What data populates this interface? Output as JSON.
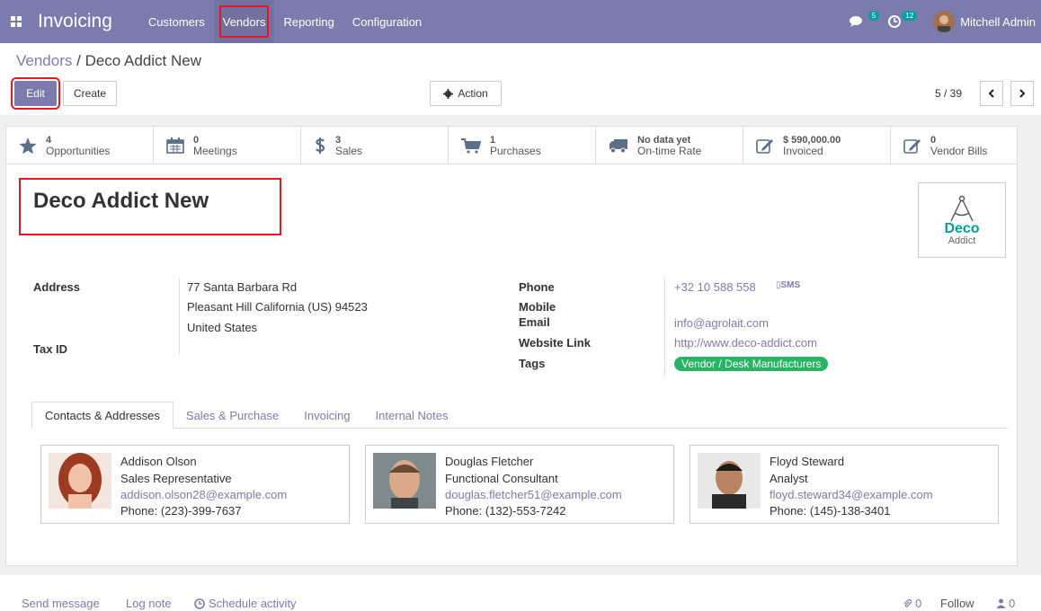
{
  "navbar": {
    "brand": "Invoicing",
    "menu": [
      "Customers",
      "Vendors",
      "Reporting",
      "Configuration"
    ],
    "messages_count": "5",
    "activities_count": "12",
    "user": "Mitchell Admin"
  },
  "breadcrumb": {
    "parent": "Vendors",
    "separator": " / ",
    "current": "Deco Addict New"
  },
  "buttons": {
    "edit": "Edit",
    "create": "Create",
    "action": "Action"
  },
  "pager": {
    "value": "5 / 39"
  },
  "stats": [
    {
      "value": "4",
      "label": "Opportunities",
      "icon": "star-icon"
    },
    {
      "value": "0",
      "label": "Meetings",
      "icon": "calendar-icon"
    },
    {
      "value": "3",
      "label": "Sales",
      "icon": "dollar-icon"
    },
    {
      "value": "1",
      "label": "Purchases",
      "icon": "cart-icon"
    },
    {
      "value": "No data yet",
      "label": "On-time Rate",
      "icon": "truck-icon"
    },
    {
      "value": "$ 590,000.00",
      "label": "Invoiced",
      "icon": "pencil-square-icon"
    },
    {
      "value": "0",
      "label": "Vendor Bills",
      "icon": "pencil-square-icon"
    }
  ],
  "record": {
    "name": "Deco Addict New",
    "logo_top": "Deco",
    "logo_bottom": "Addict"
  },
  "fields": {
    "address_label": "Address",
    "street": "77 Santa Barbara Rd",
    "city_line": "Pleasant Hill  California (US)  94523",
    "country": "United States",
    "taxid_label": "Tax ID",
    "phone_label": "Phone",
    "phone": "+32 10 588 558",
    "sms": "SMS",
    "mobile_label": "Mobile",
    "email_label": "Email",
    "email": "info@agrolait.com",
    "website_label": "Website Link",
    "website": "http://www.deco-addict.com",
    "tags_label": "Tags",
    "tag": "Vendor / Desk Manufacturers"
  },
  "tabs": [
    "Contacts & Addresses",
    "Sales & Purchase",
    "Invoicing",
    "Internal Notes"
  ],
  "contacts": [
    {
      "name": "Addison Olson",
      "function": "Sales Representative",
      "email": "addison.olson28@example.com",
      "phone": "Phone: (223)-399-7637"
    },
    {
      "name": "Douglas Fletcher",
      "function": "Functional Consultant",
      "email": "douglas.fletcher51@example.com",
      "phone": "Phone: (132)-553-7242"
    },
    {
      "name": "Floyd Steward",
      "function": "Analyst",
      "email": "floyd.steward34@example.com",
      "phone": "Phone: (145)-138-3401"
    }
  ],
  "chatter": {
    "send_message": "Send message",
    "log_note": "Log note",
    "schedule": "Schedule activity",
    "attachments": "0",
    "follow": "Follow",
    "followers": "0"
  },
  "colors": {
    "brand": "#7c7bad",
    "tag": "#28b463",
    "badge": "#00a09d",
    "highlight": "#e01b24"
  }
}
